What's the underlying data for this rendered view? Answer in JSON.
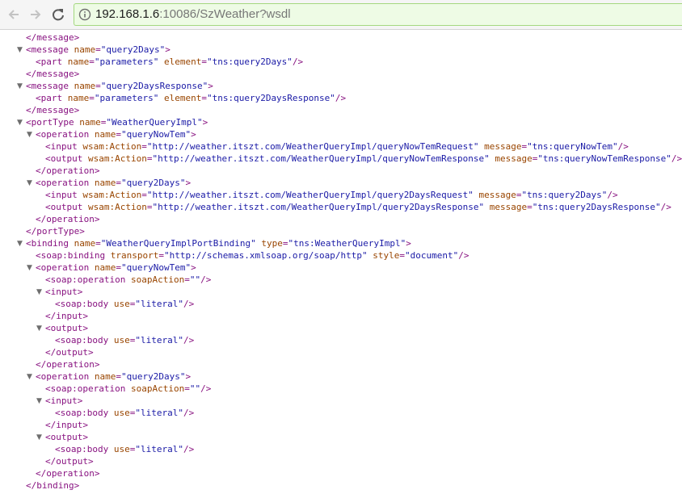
{
  "browser": {
    "back_icon": "back-arrow-icon",
    "forward_icon": "forward-arrow-icon",
    "reload_icon": "reload-icon",
    "info_icon": "info-icon",
    "url_host": "192.168.1.6",
    "url_rest": ":10086/SzWeather?wsdl"
  },
  "colors": {
    "tag": "#881280",
    "attr_name": "#994500",
    "attr_value": "#1a1aa6",
    "omnibox_bg": "#eefbe5"
  },
  "lines": [
    {
      "ind": 1,
      "arrow": false,
      "parts": [
        [
          "t",
          "</message>"
        ]
      ]
    },
    {
      "ind": 1,
      "arrow": true,
      "parts": [
        [
          "t",
          "<message "
        ],
        [
          "n",
          "name"
        ],
        [
          "t",
          "="
        ],
        [
          "v",
          "\"query2Days\""
        ],
        [
          "t",
          ">"
        ]
      ]
    },
    {
      "ind": 2,
      "arrow": false,
      "parts": [
        [
          "t",
          "<part "
        ],
        [
          "n",
          "name"
        ],
        [
          "t",
          "="
        ],
        [
          "v",
          "\"parameters\""
        ],
        [
          "t",
          " "
        ],
        [
          "n",
          "element"
        ],
        [
          "t",
          "="
        ],
        [
          "v",
          "\"tns:query2Days\""
        ],
        [
          "t",
          "/>"
        ]
      ]
    },
    {
      "ind": 1,
      "arrow": false,
      "parts": [
        [
          "t",
          "</message>"
        ]
      ]
    },
    {
      "ind": 1,
      "arrow": true,
      "parts": [
        [
          "t",
          "<message "
        ],
        [
          "n",
          "name"
        ],
        [
          "t",
          "="
        ],
        [
          "v",
          "\"query2DaysResponse\""
        ],
        [
          "t",
          ">"
        ]
      ]
    },
    {
      "ind": 2,
      "arrow": false,
      "parts": [
        [
          "t",
          "<part "
        ],
        [
          "n",
          "name"
        ],
        [
          "t",
          "="
        ],
        [
          "v",
          "\"parameters\""
        ],
        [
          "t",
          " "
        ],
        [
          "n",
          "element"
        ],
        [
          "t",
          "="
        ],
        [
          "v",
          "\"tns:query2DaysResponse\""
        ],
        [
          "t",
          "/>"
        ]
      ]
    },
    {
      "ind": 1,
      "arrow": false,
      "parts": [
        [
          "t",
          "</message>"
        ]
      ]
    },
    {
      "ind": 1,
      "arrow": true,
      "parts": [
        [
          "t",
          "<portType "
        ],
        [
          "n",
          "name"
        ],
        [
          "t",
          "="
        ],
        [
          "v",
          "\"WeatherQueryImpl\""
        ],
        [
          "t",
          ">"
        ]
      ]
    },
    {
      "ind": 2,
      "arrow": true,
      "parts": [
        [
          "t",
          "<operation "
        ],
        [
          "n",
          "name"
        ],
        [
          "t",
          "="
        ],
        [
          "v",
          "\"queryNowTem\""
        ],
        [
          "t",
          ">"
        ]
      ]
    },
    {
      "ind": 3,
      "arrow": false,
      "parts": [
        [
          "t",
          "<input "
        ],
        [
          "n",
          "wsam:Action"
        ],
        [
          "t",
          "="
        ],
        [
          "v",
          "\"http://weather.itszt.com/WeatherQueryImpl/queryNowTemRequest\""
        ],
        [
          "t",
          " "
        ],
        [
          "n",
          "message"
        ],
        [
          "t",
          "="
        ],
        [
          "v",
          "\"tns:queryNowTem\""
        ],
        [
          "t",
          "/>"
        ]
      ]
    },
    {
      "ind": 3,
      "arrow": false,
      "parts": [
        [
          "t",
          "<output "
        ],
        [
          "n",
          "wsam:Action"
        ],
        [
          "t",
          "="
        ],
        [
          "v",
          "\"http://weather.itszt.com/WeatherQueryImpl/queryNowTemResponse\""
        ],
        [
          "t",
          " "
        ],
        [
          "n",
          "message"
        ],
        [
          "t",
          "="
        ],
        [
          "v",
          "\"tns:queryNowTemResponse\""
        ],
        [
          "t",
          "/>"
        ]
      ]
    },
    {
      "ind": 2,
      "arrow": false,
      "parts": [
        [
          "t",
          "</operation>"
        ]
      ]
    },
    {
      "ind": 2,
      "arrow": true,
      "parts": [
        [
          "t",
          "<operation "
        ],
        [
          "n",
          "name"
        ],
        [
          "t",
          "="
        ],
        [
          "v",
          "\"query2Days\""
        ],
        [
          "t",
          ">"
        ]
      ]
    },
    {
      "ind": 3,
      "arrow": false,
      "parts": [
        [
          "t",
          "<input "
        ],
        [
          "n",
          "wsam:Action"
        ],
        [
          "t",
          "="
        ],
        [
          "v",
          "\"http://weather.itszt.com/WeatherQueryImpl/query2DaysRequest\""
        ],
        [
          "t",
          " "
        ],
        [
          "n",
          "message"
        ],
        [
          "t",
          "="
        ],
        [
          "v",
          "\"tns:query2Days\""
        ],
        [
          "t",
          "/>"
        ]
      ]
    },
    {
      "ind": 3,
      "arrow": false,
      "parts": [
        [
          "t",
          "<output "
        ],
        [
          "n",
          "wsam:Action"
        ],
        [
          "t",
          "="
        ],
        [
          "v",
          "\"http://weather.itszt.com/WeatherQueryImpl/query2DaysResponse\""
        ],
        [
          "t",
          " "
        ],
        [
          "n",
          "message"
        ],
        [
          "t",
          "="
        ],
        [
          "v",
          "\"tns:query2DaysResponse\""
        ],
        [
          "t",
          "/>"
        ]
      ]
    },
    {
      "ind": 2,
      "arrow": false,
      "parts": [
        [
          "t",
          "</operation>"
        ]
      ]
    },
    {
      "ind": 1,
      "arrow": false,
      "parts": [
        [
          "t",
          "</portType>"
        ]
      ]
    },
    {
      "ind": 1,
      "arrow": true,
      "parts": [
        [
          "t",
          "<binding "
        ],
        [
          "n",
          "name"
        ],
        [
          "t",
          "="
        ],
        [
          "v",
          "\"WeatherQueryImplPortBinding\""
        ],
        [
          "t",
          " "
        ],
        [
          "n",
          "type"
        ],
        [
          "t",
          "="
        ],
        [
          "v",
          "\"tns:WeatherQueryImpl\""
        ],
        [
          "t",
          ">"
        ]
      ]
    },
    {
      "ind": 2,
      "arrow": false,
      "parts": [
        [
          "t",
          "<soap:binding "
        ],
        [
          "n",
          "transport"
        ],
        [
          "t",
          "="
        ],
        [
          "v",
          "\"http://schemas.xmlsoap.org/soap/http\""
        ],
        [
          "t",
          " "
        ],
        [
          "n",
          "style"
        ],
        [
          "t",
          "="
        ],
        [
          "v",
          "\"document\""
        ],
        [
          "t",
          "/>"
        ]
      ]
    },
    {
      "ind": 2,
      "arrow": true,
      "parts": [
        [
          "t",
          "<operation "
        ],
        [
          "n",
          "name"
        ],
        [
          "t",
          "="
        ],
        [
          "v",
          "\"queryNowTem\""
        ],
        [
          "t",
          ">"
        ]
      ]
    },
    {
      "ind": 3,
      "arrow": false,
      "parts": [
        [
          "t",
          "<soap:operation "
        ],
        [
          "n",
          "soapAction"
        ],
        [
          "t",
          "="
        ],
        [
          "v",
          "\"\""
        ],
        [
          "t",
          "/>"
        ]
      ]
    },
    {
      "ind": 3,
      "arrow": true,
      "parts": [
        [
          "t",
          "<input>"
        ]
      ]
    },
    {
      "ind": 4,
      "arrow": false,
      "parts": [
        [
          "t",
          "<soap:body "
        ],
        [
          "n",
          "use"
        ],
        [
          "t",
          "="
        ],
        [
          "v",
          "\"literal\""
        ],
        [
          "t",
          "/>"
        ]
      ]
    },
    {
      "ind": 3,
      "arrow": false,
      "parts": [
        [
          "t",
          "</input>"
        ]
      ]
    },
    {
      "ind": 3,
      "arrow": true,
      "parts": [
        [
          "t",
          "<output>"
        ]
      ]
    },
    {
      "ind": 4,
      "arrow": false,
      "parts": [
        [
          "t",
          "<soap:body "
        ],
        [
          "n",
          "use"
        ],
        [
          "t",
          "="
        ],
        [
          "v",
          "\"literal\""
        ],
        [
          "t",
          "/>"
        ]
      ]
    },
    {
      "ind": 3,
      "arrow": false,
      "parts": [
        [
          "t",
          "</output>"
        ]
      ]
    },
    {
      "ind": 2,
      "arrow": false,
      "parts": [
        [
          "t",
          "</operation>"
        ]
      ]
    },
    {
      "ind": 2,
      "arrow": true,
      "parts": [
        [
          "t",
          "<operation "
        ],
        [
          "n",
          "name"
        ],
        [
          "t",
          "="
        ],
        [
          "v",
          "\"query2Days\""
        ],
        [
          "t",
          ">"
        ]
      ]
    },
    {
      "ind": 3,
      "arrow": false,
      "parts": [
        [
          "t",
          "<soap:operation "
        ],
        [
          "n",
          "soapAction"
        ],
        [
          "t",
          "="
        ],
        [
          "v",
          "\"\""
        ],
        [
          "t",
          "/>"
        ]
      ]
    },
    {
      "ind": 3,
      "arrow": true,
      "parts": [
        [
          "t",
          "<input>"
        ]
      ]
    },
    {
      "ind": 4,
      "arrow": false,
      "parts": [
        [
          "t",
          "<soap:body "
        ],
        [
          "n",
          "use"
        ],
        [
          "t",
          "="
        ],
        [
          "v",
          "\"literal\""
        ],
        [
          "t",
          "/>"
        ]
      ]
    },
    {
      "ind": 3,
      "arrow": false,
      "parts": [
        [
          "t",
          "</input>"
        ]
      ]
    },
    {
      "ind": 3,
      "arrow": true,
      "parts": [
        [
          "t",
          "<output>"
        ]
      ]
    },
    {
      "ind": 4,
      "arrow": false,
      "parts": [
        [
          "t",
          "<soap:body "
        ],
        [
          "n",
          "use"
        ],
        [
          "t",
          "="
        ],
        [
          "v",
          "\"literal\""
        ],
        [
          "t",
          "/>"
        ]
      ]
    },
    {
      "ind": 3,
      "arrow": false,
      "parts": [
        [
          "t",
          "</output>"
        ]
      ]
    },
    {
      "ind": 2,
      "arrow": false,
      "parts": [
        [
          "t",
          "</operation>"
        ]
      ]
    },
    {
      "ind": 1,
      "arrow": false,
      "parts": [
        [
          "t",
          "</binding>"
        ]
      ]
    }
  ]
}
